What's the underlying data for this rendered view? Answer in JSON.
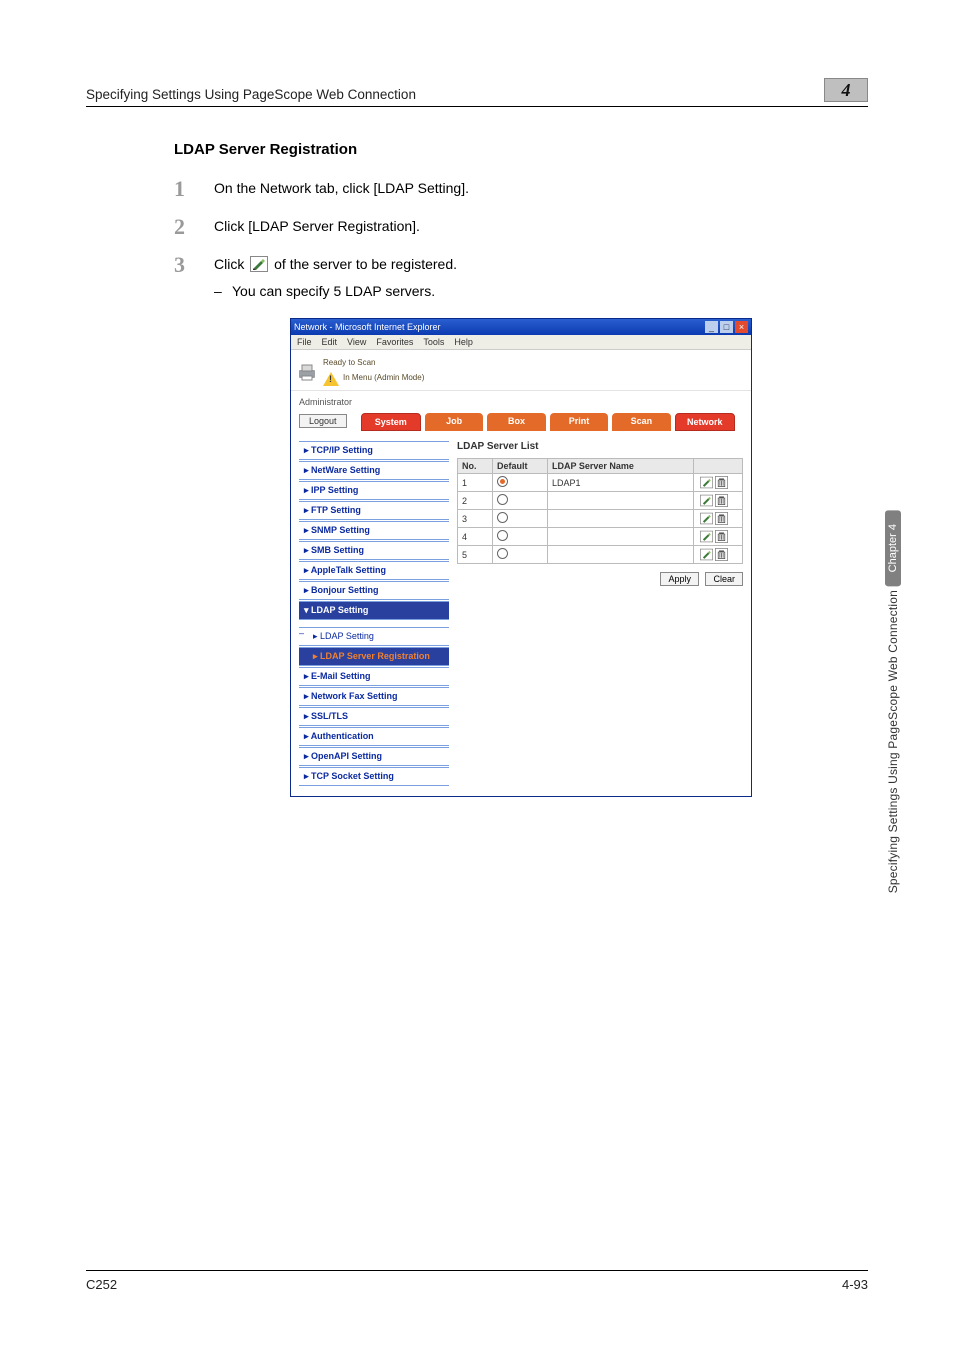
{
  "header": {
    "title": "Specifying Settings Using PageScope Web Connection",
    "section_number": "4"
  },
  "section_heading": "LDAP Server Registration",
  "steps": [
    {
      "num": "1",
      "text": "On the Network tab, click [LDAP Setting]."
    },
    {
      "num": "2",
      "text": "Click [LDAP Server Registration]."
    },
    {
      "num": "3",
      "text_before": "Click ",
      "text_after": " of the server to be registered.",
      "sub": "You can specify 5 LDAP servers."
    }
  ],
  "browser": {
    "title": "Network - Microsoft Internet Explorer",
    "menus": [
      "File",
      "Edit",
      "View",
      "Favorites",
      "Tools",
      "Help"
    ],
    "status_lines": [
      "Ready to Scan",
      "In Menu (Admin Mode)"
    ],
    "role": "Administrator",
    "logout": "Logout",
    "tabs": [
      "System",
      "Job",
      "Box",
      "Print",
      "Scan",
      "Network"
    ],
    "active_tab": "Network",
    "sidenav": [
      {
        "label": "TCP/IP Setting"
      },
      {
        "label": "NetWare Setting"
      },
      {
        "label": "IPP Setting"
      },
      {
        "label": "FTP Setting"
      },
      {
        "label": "SNMP Setting"
      },
      {
        "label": "SMB Setting"
      },
      {
        "label": "AppleTalk Setting"
      },
      {
        "label": "Bonjour Setting"
      },
      {
        "label": "LDAP Setting",
        "active": true
      },
      {
        "label": "LDAP Setting",
        "sub": true
      },
      {
        "label": "LDAP Server Registration",
        "sub_active": true
      },
      {
        "label": "E-Mail Setting"
      },
      {
        "label": "Network Fax Setting"
      },
      {
        "label": "SSL/TLS"
      },
      {
        "label": "Authentication"
      },
      {
        "label": "OpenAPI Setting"
      },
      {
        "label": "TCP Socket Setting"
      }
    ],
    "main": {
      "title": "LDAP Server List",
      "columns": [
        "No.",
        "Default",
        "LDAP Server Name",
        ""
      ],
      "rows": [
        {
          "no": "1",
          "default": true,
          "name": "LDAP1"
        },
        {
          "no": "2",
          "default": false,
          "name": ""
        },
        {
          "no": "3",
          "default": false,
          "name": ""
        },
        {
          "no": "4",
          "default": false,
          "name": ""
        },
        {
          "no": "5",
          "default": false,
          "name": ""
        }
      ],
      "buttons": [
        "Apply",
        "Clear"
      ]
    }
  },
  "side": {
    "chapter": "Chapter 4",
    "text": "Specifying Settings Using PageScope Web Connection"
  },
  "footer": {
    "left": "C252",
    "right": "4-93"
  }
}
